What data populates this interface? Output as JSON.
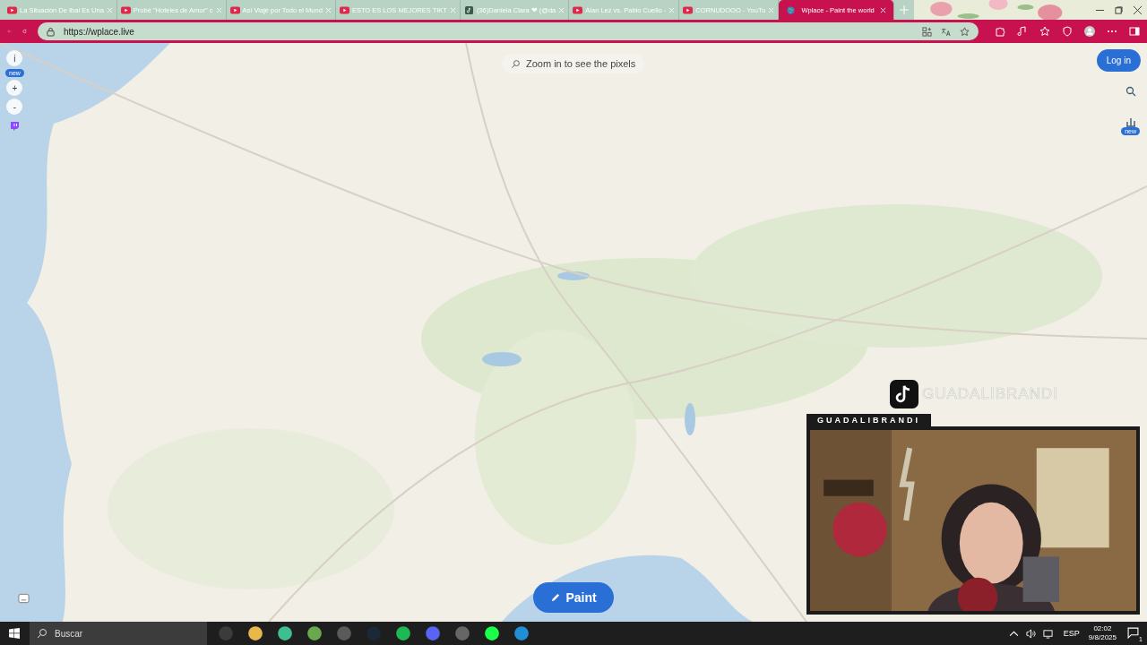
{
  "tabs": [
    {
      "title": "La Situación De Ibai Es Una",
      "kind": "youtube",
      "selected": false
    },
    {
      "title": "Probé \"Hoteles de Amor\" c",
      "kind": "youtube",
      "selected": false
    },
    {
      "title": "Así Viajé por Todo el Mund",
      "kind": "youtube",
      "selected": false
    },
    {
      "title": "ESTO ES LOS MEJORES TIKT",
      "kind": "youtube",
      "selected": false
    },
    {
      "title": "(36)Daniela Clara ❤ (@da",
      "kind": "tiktok",
      "selected": false
    },
    {
      "title": "Alan Lez vs. Pablo Cuello - ",
      "kind": "youtube",
      "selected": false
    },
    {
      "title": "CORNUDOOO - YouTu",
      "kind": "youtube",
      "selected": false
    },
    {
      "title": "Wplace - Paint the world",
      "kind": "globe",
      "selected": true
    }
  ],
  "address": {
    "url": "https://wplace.live"
  },
  "map": {
    "kind": "picture",
    "zoom_hint": "Zoom in to see the pixels",
    "login_button": "Log in",
    "left_controls": [
      {
        "label": "i",
        "badge": "new"
      },
      {
        "label": "+"
      },
      {
        "label": "-"
      }
    ],
    "right_badge": "new",
    "paint_button": "Paint"
  },
  "stream_overlay": {
    "watermark": "GUADALIBRANDI",
    "name_tag": "GUADALIBRANDI"
  },
  "taskbar": {
    "search_placeholder": "Buscar",
    "language": "ESP",
    "time": "02:02",
    "date": "9/8/2025",
    "notifications": "1"
  }
}
